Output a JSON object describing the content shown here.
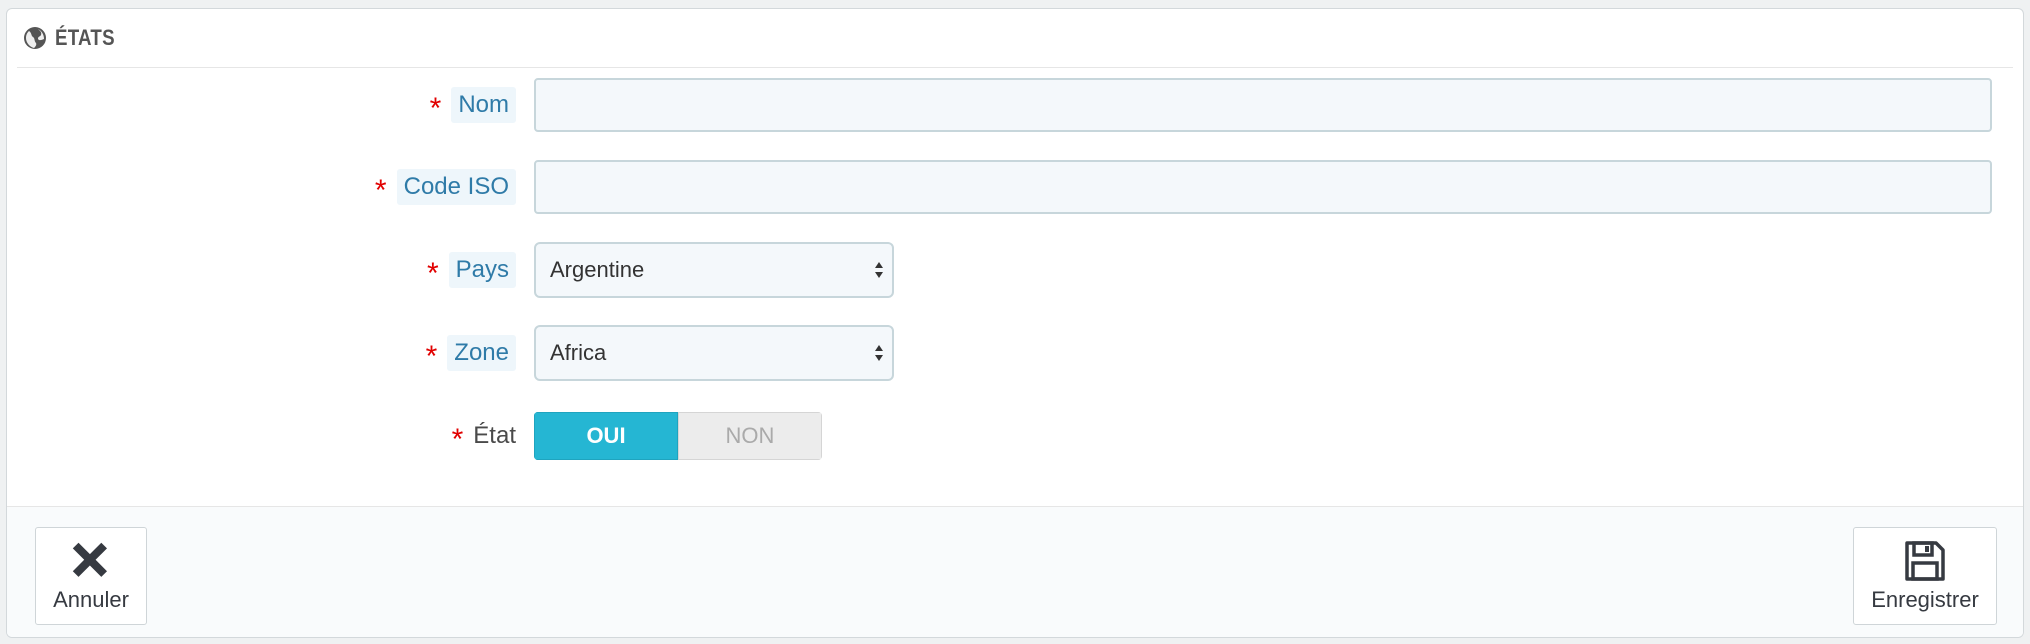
{
  "panel": {
    "title": "ÉTATS",
    "title_icon": "globe-icon"
  },
  "form": {
    "required_mark": "*",
    "name": {
      "label": "Nom",
      "value": "",
      "required": true
    },
    "iso_code": {
      "label": "Code ISO",
      "value": "",
      "required": true
    },
    "country": {
      "label": "Pays",
      "selected": "Argentine",
      "required": true
    },
    "zone": {
      "label": "Zone",
      "selected": "Africa",
      "required": true
    },
    "status": {
      "label": "État",
      "on_label": "OUI",
      "off_label": "NON",
      "value": "OUI",
      "required": true
    }
  },
  "footer": {
    "cancel_label": "Annuler",
    "cancel_icon": "close-icon",
    "save_label": "Enregistrer",
    "save_icon": "floppy-disk-icon"
  },
  "colors": {
    "accent": "#25b6d3",
    "required": "#e10000",
    "label_text": "#2f7ba8",
    "label_bg": "#eef6fb"
  }
}
